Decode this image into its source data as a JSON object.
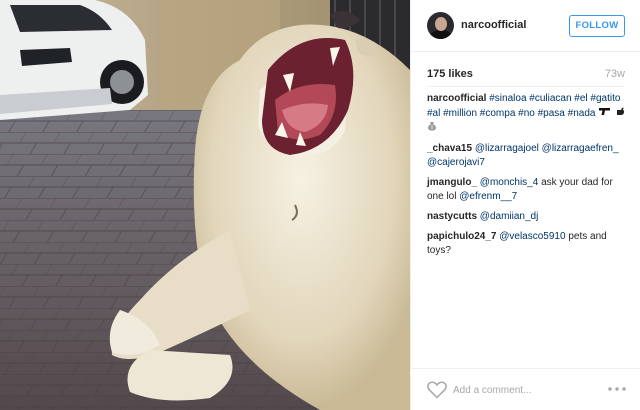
{
  "photo": {
    "description_icon": "lion-photo"
  },
  "header": {
    "username": "narcoofficial",
    "follow_label": "FOLLOW",
    "avatar_icon": "avatar"
  },
  "stats": {
    "likes": "175 likes",
    "time_ago": "73w"
  },
  "caption": {
    "author": "narcoofficial",
    "text": "#sinaloa #culiacan #el #gatito #al #million #compa #no #pasa #nada",
    "icons": [
      "gun-icon",
      "point-icon",
      "money-bag-icon"
    ]
  },
  "comments": [
    {
      "author": "_chava15",
      "text": "@lizarragajoel @lizarragaefren_ @cajerojavi7"
    },
    {
      "author": "jmangulo_",
      "mention": "@monchis_4",
      "text": " ask your dad for one lol ",
      "mention2": "@efrenm__7"
    },
    {
      "author": "nastycutts",
      "text": "@damiian_dj"
    },
    {
      "author": "papichulo24_7",
      "mention": "@velasco5910",
      "text": " pets and toys?"
    }
  ],
  "footer": {
    "placeholder": "Add a comment...",
    "heart_icon": "heart-icon",
    "more_icon": "more-options-icon"
  }
}
